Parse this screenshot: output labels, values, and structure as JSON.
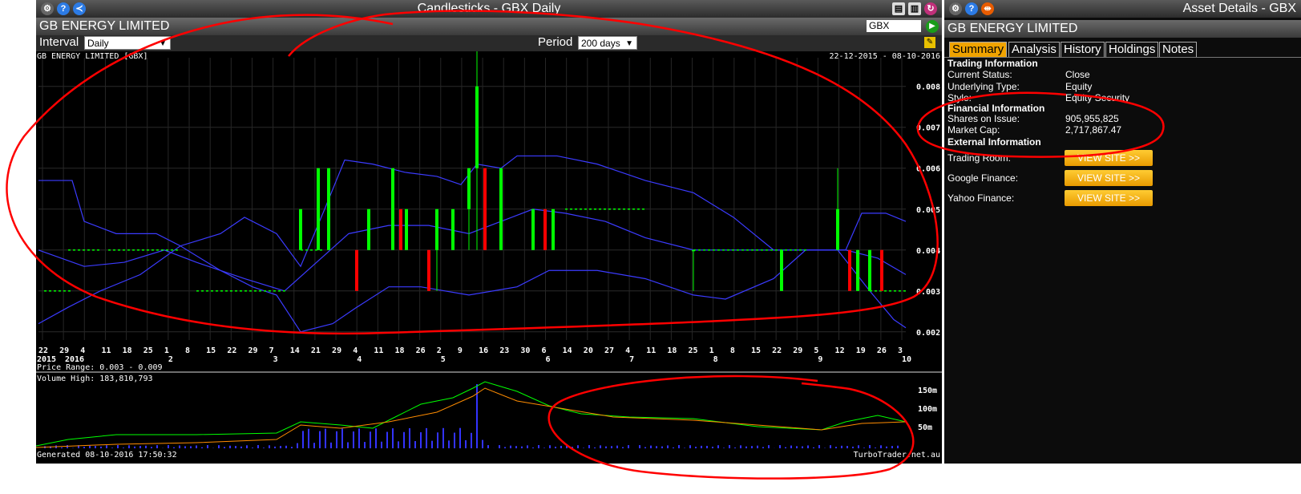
{
  "chart_window": {
    "title": "Candlesticks - GBX Daily",
    "company": "GB ENERGY LIMITED",
    "symbol_input": "GBX",
    "interval_label": "Interval",
    "interval_value": "Daily",
    "period_label": "Period",
    "period_value": "200 days",
    "chart_heading": "GB ENERGY LIMITED [GBX]",
    "date_range": "22-12-2015 - 08-10-2016",
    "price_range_text": "Price Range: 0.003 - 0.009",
    "volume_high_text": "Volume High: 183,810,793",
    "generated_text": "Generated 08-10-2016 17:50:32",
    "watermark": "TurboTrader.net.au",
    "accent": "#ff0000",
    "up_color": "#00ff00",
    "down_color": "#ff0000",
    "band_color": "#3b3bff",
    "volume_ma_colors": [
      "#00ff00",
      "#ff8c00"
    ]
  },
  "chart_data": {
    "type": "candlestick",
    "price_axis_ticks": [
      "0.008",
      "0.007",
      "0.006",
      "0.005",
      "0.004",
      "0.003",
      "0.002"
    ],
    "price_ylim": [
      0.0018,
      0.0087
    ],
    "volume_axis_ticks": [
      "150m",
      "100m",
      "50m"
    ],
    "x_day_labels": [
      "22",
      "29",
      "4",
      "11",
      "18",
      "25",
      "1",
      "8",
      "15",
      "22",
      "29",
      "7",
      "14",
      "21",
      "29",
      "4",
      "11",
      "18",
      "26",
      "2",
      "9",
      "16",
      "23",
      "30",
      "6",
      "14",
      "20",
      "27",
      "4",
      "11",
      "18",
      "25",
      "1",
      "8",
      "15",
      "22",
      "29",
      "5",
      "12",
      "19",
      "26",
      "3"
    ],
    "x_month_labels": [
      "2015",
      "2016",
      "2",
      "3",
      "4",
      "5",
      "6",
      "7",
      "8",
      "9",
      "10"
    ],
    "price_range": [
      0.003,
      0.009
    ],
    "volume_high": 183810793
  },
  "asset_window": {
    "title": "Asset Details - GBX",
    "company": "GB ENERGY LIMITED",
    "tabs": [
      "Summary",
      "Analysis",
      "History",
      "Holdings",
      "Notes"
    ],
    "active_tab": "Summary",
    "trading_header": "Trading Information",
    "trading": [
      {
        "label": "Current Status:",
        "value": "Close"
      },
      {
        "label": "Underlying Type:",
        "value": "Equity"
      },
      {
        "label": "Style:",
        "value": "Equity Security"
      }
    ],
    "financial_header": "Financial Information",
    "financial": [
      {
        "label": "Shares on Issue:",
        "value": "905,955,825"
      },
      {
        "label": "Market Cap:",
        "value": "2,717,867.47"
      }
    ],
    "external_header": "External Information",
    "external": [
      {
        "label": "Trading Room:",
        "button": "VIEW SITE >>"
      },
      {
        "label": "Google Finance:",
        "button": "VIEW SITE >>"
      },
      {
        "label": "Yahoo Finance:",
        "button": "VIEW SITE >>"
      }
    ]
  }
}
